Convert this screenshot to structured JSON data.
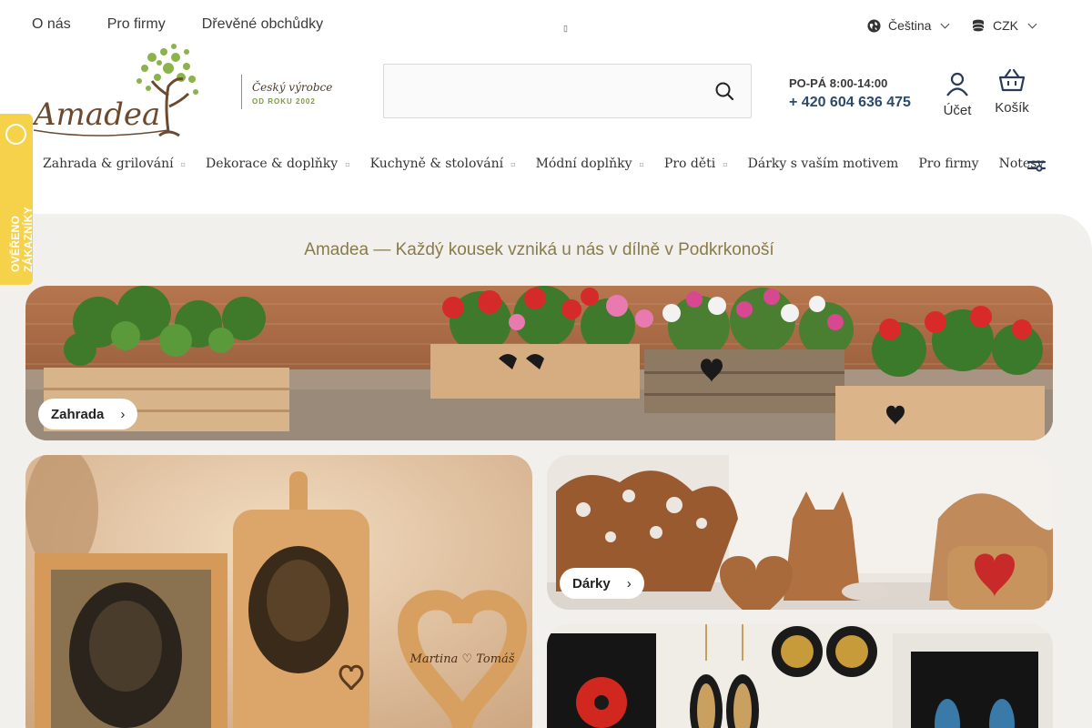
{
  "top_links": [
    "O nás",
    "Pro firmy",
    "Dřevěné obchůdky"
  ],
  "tiny_glyph": "▯",
  "language": "Čeština",
  "currency": "CZK",
  "brand": {
    "logo_text": "Amadea",
    "tagline_1": "Český výrobce",
    "tagline_2": "OD ROKU 2002"
  },
  "search": {
    "placeholder": ""
  },
  "contact": {
    "hours": "PO-PÁ 8:00-14:00",
    "phone": "+ 420 604 636 475"
  },
  "account_label": "Účet",
  "cart_label": "Košík",
  "nav": [
    "Zahrada & grilování",
    "Dekorace & doplňky",
    "Kuchyně & stolování",
    "Módní doplňky",
    "Pro děti",
    "Dárky s vaším motivem",
    "Pro firmy",
    "Notesy"
  ],
  "nav_dot": "▫",
  "badge_text": "OVĚŘENO ZÁKAZNÍKY",
  "headline": "Amadea — Každý kousek vzniká u nás v dílně v Podkrkonoší",
  "tiles": {
    "garden": {
      "label": "Zahrada",
      "arrow": "›"
    },
    "gifts": {
      "label": "Dárky",
      "arrow": "›"
    },
    "engraving_heart_text": "Martina ♡ Tomáš"
  },
  "colors": {
    "badge": "#f5d24a",
    "phone": "#2b4a6a",
    "headline": "#8a7a4a",
    "content_bg": "#f1f0ed"
  }
}
